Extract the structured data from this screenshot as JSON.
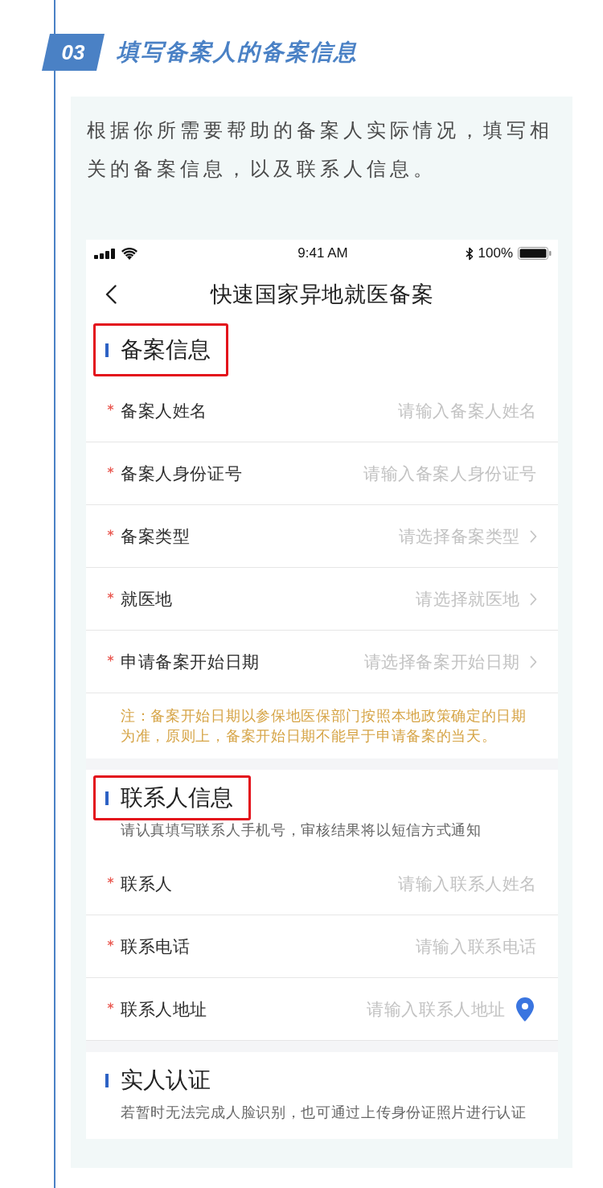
{
  "step": {
    "number": "03",
    "title": "填写备案人的备案信息"
  },
  "intro": "根据你所需要帮助的备案人实际情况，填写相关的备案信息，以及联系人信息。",
  "phone": {
    "status_bar": {
      "time": "9:41 AM",
      "battery": "100%"
    },
    "nav": {
      "title": "快速国家异地就医备案"
    },
    "sections": [
      {
        "title": "备案信息",
        "highlighted": true,
        "fields": [
          {
            "label": "备案人姓名",
            "kind": "input",
            "required": true,
            "placeholder": "请输入备案人姓名"
          },
          {
            "label": "备案人身份证号",
            "kind": "input",
            "required": true,
            "placeholder": "请输入备案人身份证号"
          },
          {
            "label": "备案类型",
            "kind": "select",
            "required": true,
            "placeholder": "请选择备案类型"
          },
          {
            "label": "就医地",
            "kind": "select",
            "required": true,
            "placeholder": "请选择就医地"
          },
          {
            "label": "申请备案开始日期",
            "kind": "select",
            "required": true,
            "placeholder": "请选择备案开始日期"
          }
        ],
        "note": "注：备案开始日期以参保地医保部门按照本地政策确定的日期为准，原则上，备案开始日期不能早于申请备案的当天。"
      },
      {
        "title": "联系人信息",
        "highlighted": true,
        "subtitle": "请认真填写联系人手机号，审核结果将以短信方式通知",
        "fields": [
          {
            "label": "联系人",
            "kind": "input",
            "required": true,
            "placeholder": "请输入联系人姓名"
          },
          {
            "label": "联系电话",
            "kind": "input",
            "required": true,
            "placeholder": "请输入联系电话"
          },
          {
            "label": "联系人地址",
            "kind": "location",
            "required": true,
            "placeholder": "请输入联系人地址"
          }
        ]
      },
      {
        "title": "实人认证",
        "highlighted": false,
        "subtitle": "若暂时无法完成人脸识别，也可通过上传身份证照片进行认证"
      }
    ]
  }
}
